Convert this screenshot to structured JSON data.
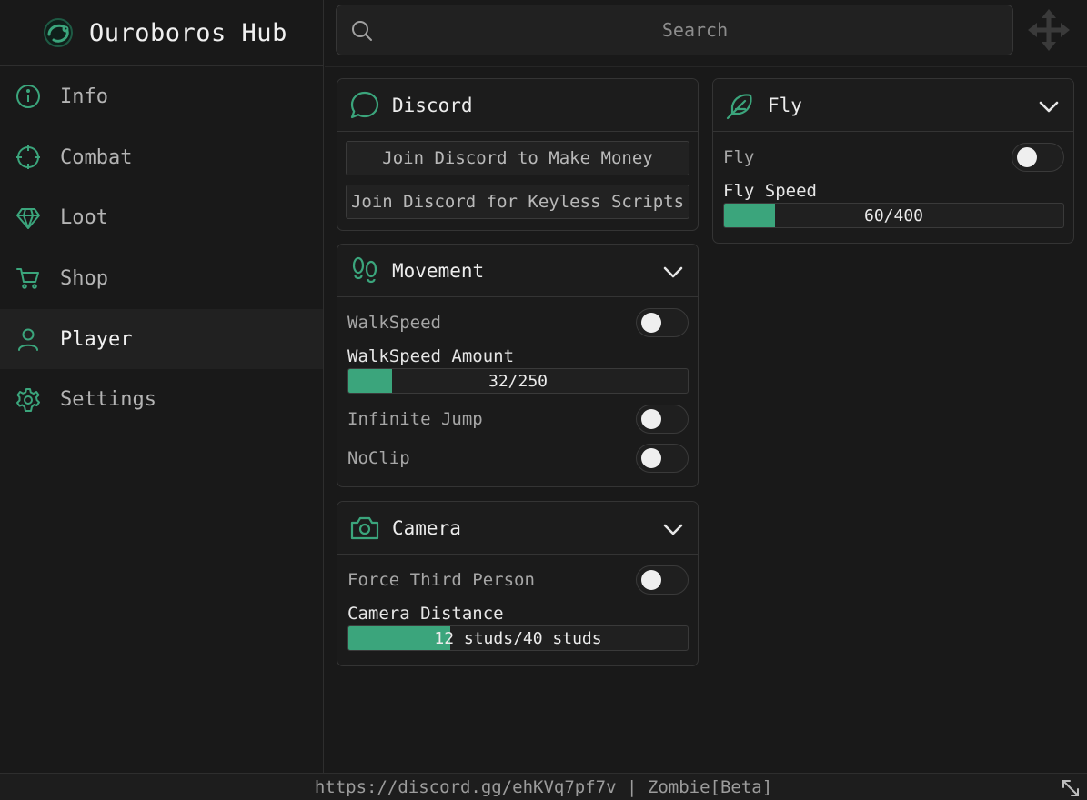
{
  "app": {
    "title": "Ouroboros Hub",
    "accent": "#3ba57c"
  },
  "sidebar": {
    "items": [
      {
        "label": "Info",
        "icon": "info-icon",
        "active": false
      },
      {
        "label": "Combat",
        "icon": "crosshair-icon",
        "active": false
      },
      {
        "label": "Loot",
        "icon": "gem-icon",
        "active": false
      },
      {
        "label": "Shop",
        "icon": "cart-icon",
        "active": false
      },
      {
        "label": "Player",
        "icon": "user-icon",
        "active": true
      },
      {
        "label": "Settings",
        "icon": "gear-icon",
        "active": false
      }
    ]
  },
  "search": {
    "placeholder": "Search",
    "value": ""
  },
  "discord": {
    "title": "Discord",
    "icon": "chat-bubble-icon",
    "buttons": [
      "Join Discord to Make Money",
      "Join Discord for Keyless Scripts"
    ]
  },
  "movement": {
    "title": "Movement",
    "icon": "footprints-icon",
    "walkspeed_label": "WalkSpeed",
    "walkspeed_on": false,
    "walkspeed_amount_label": "WalkSpeed Amount",
    "walkspeed_amount": {
      "value": 32,
      "max": 250,
      "text": "32/250"
    },
    "infinite_jump_label": "Infinite Jump",
    "infinite_jump_on": false,
    "noclip_label": "NoClip",
    "noclip_on": false
  },
  "camera": {
    "title": "Camera",
    "icon": "camera-icon",
    "third_person_label": "Force Third Person",
    "third_person_on": false,
    "distance_label": "Camera Distance",
    "distance": {
      "value": 12,
      "max": 40,
      "text": "12 studs/40 studs"
    }
  },
  "fly": {
    "title": "Fly",
    "icon": "feather-icon",
    "fly_label": "Fly",
    "fly_on": false,
    "speed_label": "Fly Speed",
    "speed": {
      "value": 60,
      "max": 400,
      "text": "60/400"
    }
  },
  "footer": {
    "text": "https://discord.gg/ehKVq7pf7v | Zombie[Beta]"
  }
}
